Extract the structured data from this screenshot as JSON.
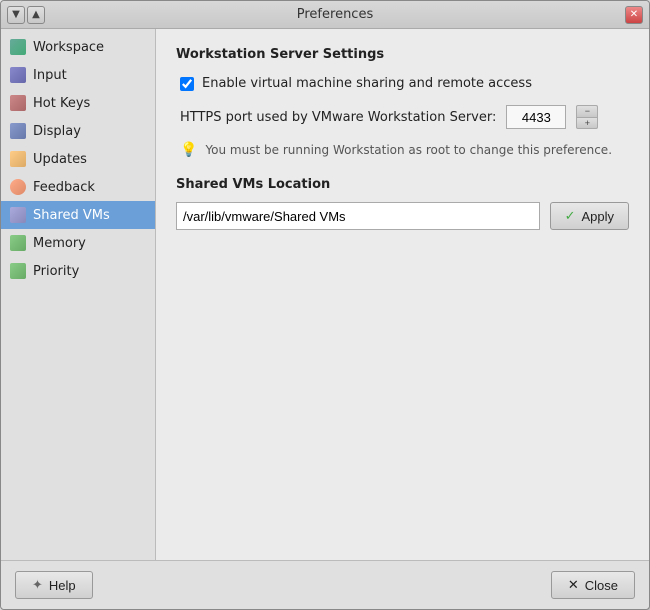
{
  "window": {
    "title": "Preferences"
  },
  "titlebar": {
    "minimize_label": "▼",
    "maximize_label": "▲",
    "close_label": "✕"
  },
  "sidebar": {
    "items": [
      {
        "id": "workspace",
        "label": "Workspace",
        "icon": "workspace-icon",
        "active": false
      },
      {
        "id": "input",
        "label": "Input",
        "icon": "input-icon",
        "active": false
      },
      {
        "id": "hotkeys",
        "label": "Hot Keys",
        "icon": "hotkeys-icon",
        "active": false
      },
      {
        "id": "display",
        "label": "Display",
        "icon": "display-icon",
        "active": false
      },
      {
        "id": "updates",
        "label": "Updates",
        "icon": "updates-icon",
        "active": false
      },
      {
        "id": "feedback",
        "label": "Feedback",
        "icon": "feedback-icon",
        "active": false
      },
      {
        "id": "sharedvms",
        "label": "Shared VMs",
        "icon": "sharedvms-icon",
        "active": true
      },
      {
        "id": "memory",
        "label": "Memory",
        "icon": "memory-icon",
        "active": false
      },
      {
        "id": "priority",
        "label": "Priority",
        "icon": "priority-icon",
        "active": false
      }
    ]
  },
  "content": {
    "section_title": "Workstation Server Settings",
    "checkbox_label": "Enable virtual machine sharing and remote access",
    "checkbox_checked": true,
    "https_label": "HTTPS port used by VMware Workstation Server:",
    "port_value": "4433",
    "info_text": "You must be running Workstation as root to change this preference.",
    "shared_vms_title": "Shared VMs Location",
    "path_value": "/var/lib/vmware/Shared VMs",
    "apply_label": "Apply"
  },
  "bottom": {
    "help_label": "Help",
    "close_label": "Close"
  }
}
